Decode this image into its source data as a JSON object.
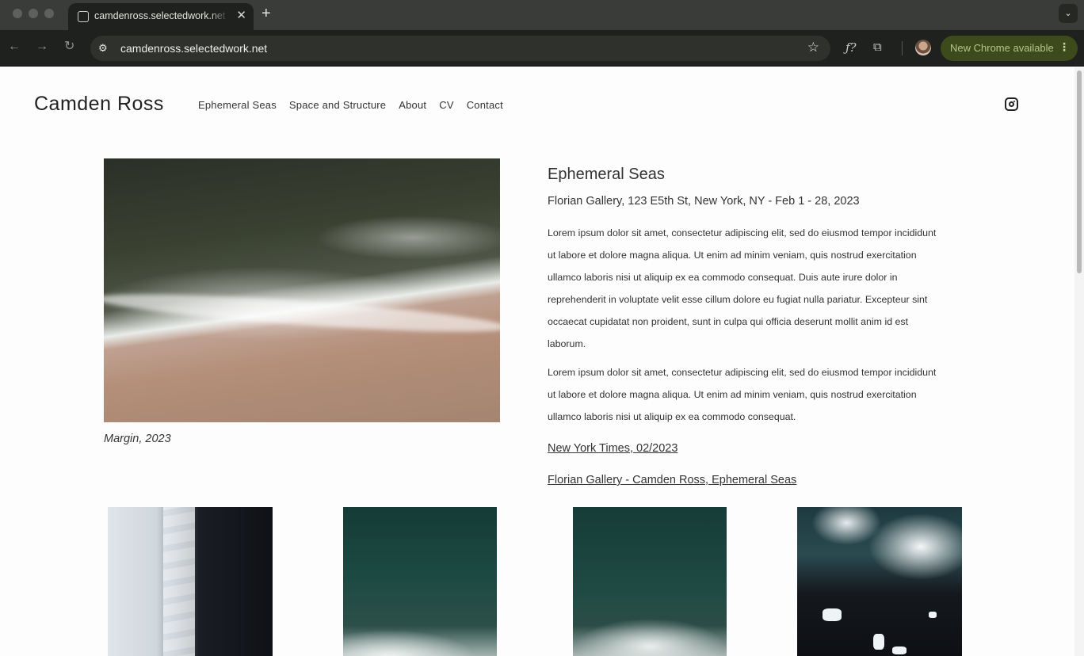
{
  "browser": {
    "tab_title": "camdenross.selectedwork.net",
    "tab_close": "✕",
    "new_tab": "+",
    "tab_menu": "⌄",
    "url": "camdenross.selectedwork.net",
    "update_label": "New Chrome available",
    "icons": {
      "back": "←",
      "forward": "→",
      "reload": "↻",
      "site_info": "⚙",
      "bookmark": "☆",
      "extension_fx": "ƒ?",
      "extensions": "⧉",
      "menu": "⋮"
    }
  },
  "site": {
    "title": "Camden Ross",
    "nav": [
      "Ephemeral Seas",
      "Space and Structure",
      "About",
      "CV",
      "Contact"
    ]
  },
  "hero": {
    "caption": "Margin, 2023"
  },
  "exhibition": {
    "title": "Ephemeral Seas",
    "venue": "Florian Gallery, 123 E5th St, New York, NY - Feb 1 - 28, 2023",
    "paragraphs": [
      "Lorem ipsum dolor sit amet, consectetur adipiscing elit, sed do eiusmod tempor incididunt ut labore et dolore magna aliqua. Ut enim ad minim veniam, quis nostrud exercitation ullamco laboris nisi ut aliquip ex ea commodo consequat. Duis aute irure dolor in reprehenderit in voluptate velit esse cillum dolore eu fugiat nulla pariatur. Excepteur sint occaecat cupidatat non proident, sunt in culpa qui officia deserunt mollit anim id est laborum.",
      "Lorem ipsum dolor sit amet, consectetur adipiscing elit, sed do eiusmod tempor incididunt ut labore et dolore magna aliqua. Ut enim ad minim veniam, quis nostrud exercitation ullamco laboris nisi ut aliquip ex ea commodo consequat."
    ],
    "links": [
      "New York Times, 02/2023",
      "Florian Gallery - Camden Ross, Ephemeral Seas"
    ]
  }
}
